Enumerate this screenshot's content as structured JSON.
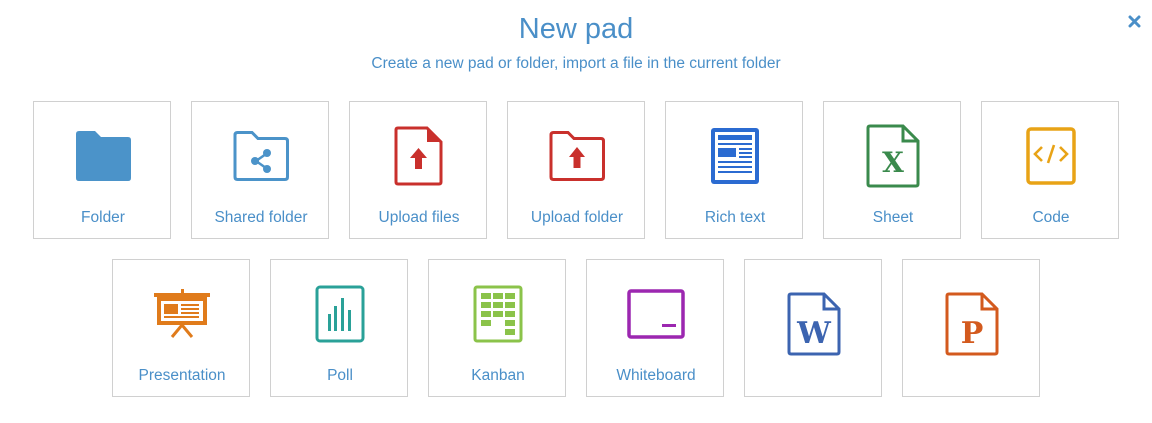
{
  "dialog": {
    "title": "New pad",
    "subtitle": "Create a new pad or folder, import a file in the current folder",
    "close_icon": "close-icon"
  },
  "colors": {
    "accent": "#4a8fc8",
    "folder": "#4b93c9",
    "shared_folder": "#4b93c9",
    "upload": "#c9302c",
    "richtext": "#2b6bd1",
    "sheet": "#3a8a4c",
    "code": "#e8a316",
    "presentation": "#e07b1b",
    "poll": "#2aa198",
    "kanban": "#8bc34a",
    "whiteboard": "#9c27b0",
    "word": "#3c64b0",
    "powerpoint": "#d35a1e"
  },
  "tiles_row1": [
    {
      "label": "Folder",
      "icon": "folder-icon"
    },
    {
      "label": "Shared folder",
      "icon": "shared-folder-icon"
    },
    {
      "label": "Upload files",
      "icon": "upload-file-icon"
    },
    {
      "label": "Upload folder",
      "icon": "upload-folder-icon"
    },
    {
      "label": "Rich text",
      "icon": "rich-text-icon"
    },
    {
      "label": "Sheet",
      "icon": "sheet-icon"
    },
    {
      "label": "Code",
      "icon": "code-icon"
    }
  ],
  "tiles_row2": [
    {
      "label": "Presentation",
      "icon": "presentation-icon"
    },
    {
      "label": "Poll",
      "icon": "poll-icon"
    },
    {
      "label": "Kanban",
      "icon": "kanban-icon"
    },
    {
      "label": "Whiteboard",
      "icon": "whiteboard-icon"
    },
    {
      "label": "",
      "icon": "word-document-icon",
      "glyph": "W"
    },
    {
      "label": "",
      "icon": "powerpoint-document-icon",
      "glyph": "P"
    }
  ]
}
